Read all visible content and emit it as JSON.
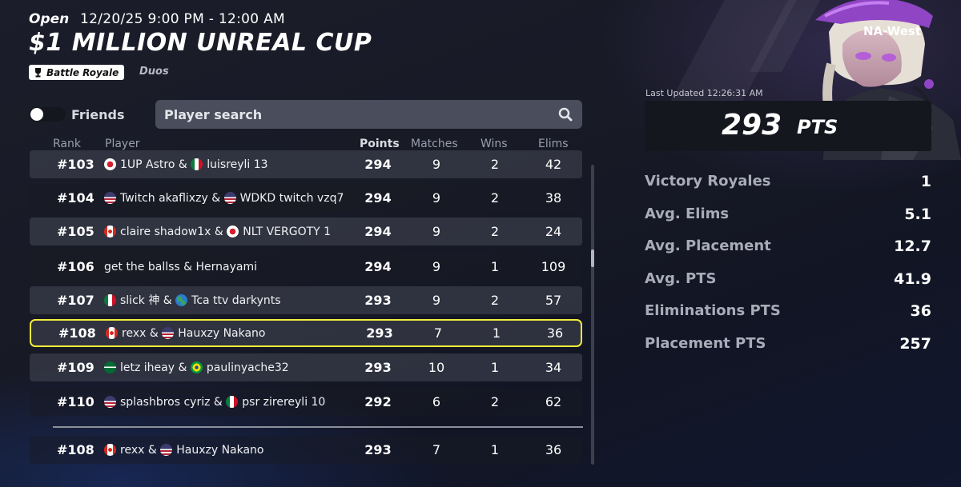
{
  "event": {
    "status": "Open",
    "datetime": "12/20/25 9:00 PM - 12:00 AM",
    "title": "$1 MILLION UNREAL CUP",
    "mode": "Battle Royale",
    "team_size": "Duos",
    "mode_icon": "trophy-icon"
  },
  "filters": {
    "friends_label": "Friends",
    "friends_on": false,
    "search_placeholder": "Player search"
  },
  "table": {
    "columns": [
      "Rank",
      "Player",
      "Points",
      "Matches",
      "Wins",
      "Elims"
    ],
    "rows": [
      {
        "rank": "#103",
        "p1": "1UP Astro",
        "f1": "japan",
        "p2": "luisreyli 13",
        "f2": "mexico",
        "points": "294",
        "matches": "9",
        "wins": "2",
        "elims": "42"
      },
      {
        "rank": "#104",
        "p1": "Twitch akaflixzy",
        "f1": "usa",
        "p2": "WDKD twitch vzq7",
        "f2": "usa",
        "points": "294",
        "matches": "9",
        "wins": "2",
        "elims": "38"
      },
      {
        "rank": "#105",
        "p1": "claire shadow1x",
        "f1": "canada",
        "p2": "NLT VERGOTY 1",
        "f2": "japan",
        "points": "294",
        "matches": "9",
        "wins": "2",
        "elims": "24"
      },
      {
        "rank": "#106",
        "p1": "get the ballss",
        "f1": "",
        "p2": "Hernayami",
        "f2": "",
        "points": "294",
        "matches": "9",
        "wins": "1",
        "elims": "109"
      },
      {
        "rank": "#107",
        "p1": "slick 神",
        "f1": "mexico",
        "p2": "Tca ttv darkynts",
        "f2": "globe",
        "points": "293",
        "matches": "9",
        "wins": "2",
        "elims": "57"
      },
      {
        "rank": "#108",
        "p1": "rexx",
        "f1": "canada",
        "p2": "Hauxzy Nakano",
        "f2": "usa",
        "points": "293",
        "matches": "7",
        "wins": "1",
        "elims": "36"
      },
      {
        "rank": "#109",
        "p1": "letz iheay",
        "f1": "saudi",
        "p2": "paulinyache32",
        "f2": "brazil",
        "points": "293",
        "matches": "10",
        "wins": "1",
        "elims": "34"
      },
      {
        "rank": "#110",
        "p1": "splashbros cyriz",
        "f1": "usa",
        "p2": "psr zirereyli 10",
        "f2": "mexico",
        "points": "292",
        "matches": "6",
        "wins": "2",
        "elims": "62"
      }
    ],
    "highlighted_rank": "#108",
    "own_row": {
      "rank": "#108",
      "p1": "rexx",
      "f1": "canada",
      "p2": "Hauxzy Nakano",
      "f2": "usa",
      "points": "293",
      "matches": "7",
      "wins": "1",
      "elims": "36"
    },
    "scroll_position": 0.3,
    "joiner": "&"
  },
  "summary": {
    "region": "NA-West",
    "last_updated": "Last Updated 12:26:31 AM",
    "points": "293",
    "points_unit": "PTS",
    "stats": [
      {
        "label": "Victory Royales",
        "value": "1"
      },
      {
        "label": "Avg. Elims",
        "value": "5.1"
      },
      {
        "label": "Avg. Placement",
        "value": "12.7"
      },
      {
        "label": "Avg. PTS",
        "value": "41.9"
      },
      {
        "label": "Eliminations PTS",
        "value": "36"
      },
      {
        "label": "Placement PTS",
        "value": "257"
      }
    ]
  },
  "colors": {
    "highlight": "#f2ee3b",
    "background": "#171925",
    "panel": "#15171f"
  }
}
